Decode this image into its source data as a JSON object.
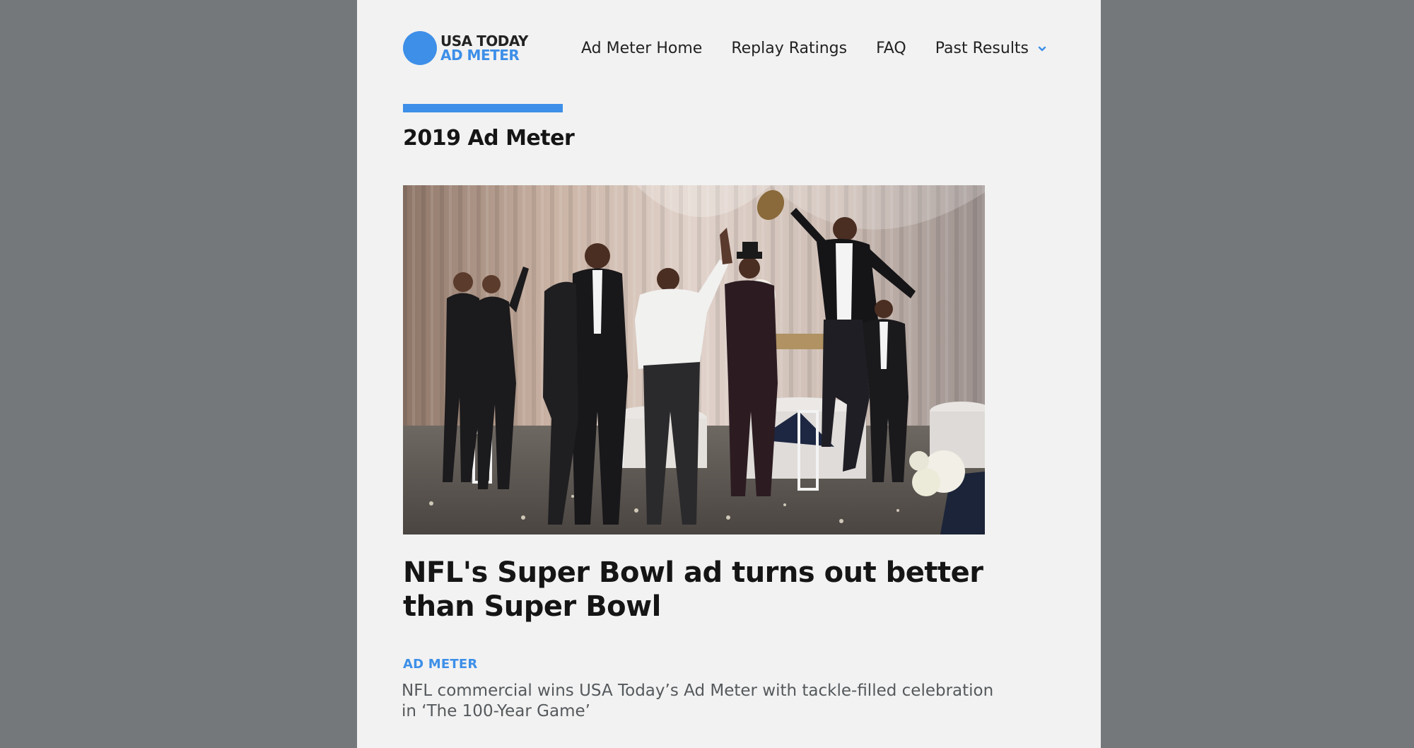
{
  "colors": {
    "accent": "#3d8fe8",
    "background": "#75787b",
    "page": "#f2f2f2",
    "text": "#151515"
  },
  "logo": {
    "line1": "USA TODAY",
    "line2": "AD METER"
  },
  "nav": {
    "items": [
      {
        "label": "Ad Meter Home"
      },
      {
        "label": "Replay Ratings"
      },
      {
        "label": "FAQ"
      },
      {
        "label": "Past Results",
        "icon": "chevron-down-icon"
      }
    ]
  },
  "section": {
    "title": "2019 Ad Meter"
  },
  "article": {
    "image_description": "NFL players in tuxedos leaping to catch a football in a banquet hall",
    "headline": "NFL's Super Bowl ad turns out better than Super Bowl",
    "category": "AD METER",
    "summary": "NFL commercial wins USA Today’s Ad Meter with tackle-filled celebration in ‘The 100-Year Game’"
  }
}
